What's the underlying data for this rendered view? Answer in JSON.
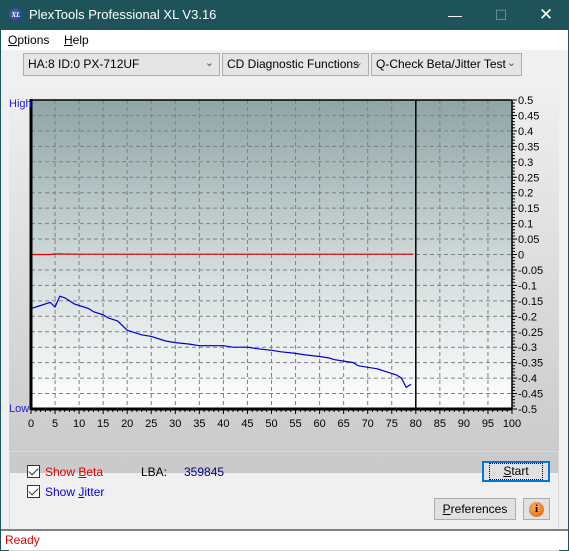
{
  "window": {
    "title": "PlexTools Professional XL V3.16",
    "icon_text": "XL",
    "controls": [
      "minimize",
      "maximize",
      "close"
    ]
  },
  "menu": {
    "items": [
      {
        "label": "Options",
        "mnemonic": "O",
        "rest": "ptions"
      },
      {
        "label": "Help",
        "mnemonic": "H",
        "rest": "elp"
      }
    ]
  },
  "toolbar": {
    "drive_select": "HA:8 ID:0  PX-712UF",
    "function_select": "CD Diagnostic Functions",
    "test_select": "Q-Check Beta/Jitter Test"
  },
  "chart_data": {
    "type": "line",
    "title": "",
    "left_axis_labels": {
      "high": "High",
      "low": "Low"
    },
    "xlabel": "",
    "ylabel": "",
    "xlim": [
      0,
      100
    ],
    "ylim": [
      -0.5,
      0.5
    ],
    "x_ticks": [
      0,
      5,
      10,
      15,
      20,
      25,
      30,
      35,
      40,
      45,
      50,
      55,
      60,
      65,
      70,
      75,
      80,
      85,
      90,
      95,
      100
    ],
    "y_ticks": [
      0.5,
      0.45,
      0.4,
      0.35,
      0.3,
      0.25,
      0.2,
      0.15,
      0.1,
      0.05,
      0,
      -0.05,
      -0.1,
      -0.15,
      -0.2,
      -0.25,
      -0.3,
      -0.35,
      -0.4,
      -0.45,
      -0.5
    ],
    "y_tick_labels": [
      "0.5",
      "0.45",
      "0.4",
      "0.35",
      "0.3",
      "0.25",
      "0.2",
      "0.15",
      "0.1",
      "0.05",
      "0",
      "-0.05",
      "-0.1",
      "-0.15",
      "-0.2",
      "-0.25",
      "-0.3",
      "-0.35",
      "-0.4",
      "-0.45",
      "-0.5"
    ],
    "grid": true,
    "end_marker_x": 80,
    "series": [
      {
        "name": "Beta",
        "color": "#e00000",
        "x": [
          0,
          4,
          5,
          10,
          15,
          20,
          30,
          40,
          50,
          60,
          70,
          79.5
        ],
        "y": [
          0,
          0,
          0.002,
          0.001,
          0.001,
          0.001,
          0.001,
          0.001,
          0.001,
          0.001,
          0.001,
          0.001
        ]
      },
      {
        "name": "Jitter",
        "color": "#0000cc",
        "x": [
          0,
          2,
          3,
          4,
          5,
          6,
          7,
          8,
          9,
          10,
          12,
          13,
          15,
          16,
          17,
          18,
          19,
          20,
          21,
          23,
          25,
          27,
          28,
          30,
          33,
          35,
          37,
          40,
          42,
          45,
          47,
          50,
          52,
          55,
          57,
          60,
          62,
          63,
          65,
          67,
          68,
          70,
          72,
          74,
          76,
          77,
          78,
          79
        ],
        "y": [
          -0.175,
          -0.165,
          -0.16,
          -0.155,
          -0.17,
          -0.135,
          -0.14,
          -0.15,
          -0.16,
          -0.165,
          -0.175,
          -0.185,
          -0.195,
          -0.205,
          -0.21,
          -0.215,
          -0.23,
          -0.245,
          -0.25,
          -0.26,
          -0.265,
          -0.275,
          -0.28,
          -0.285,
          -0.29,
          -0.295,
          -0.295,
          -0.295,
          -0.3,
          -0.3,
          -0.305,
          -0.31,
          -0.315,
          -0.32,
          -0.325,
          -0.33,
          -0.335,
          -0.34,
          -0.345,
          -0.35,
          -0.36,
          -0.365,
          -0.37,
          -0.38,
          -0.39,
          -0.4,
          -0.43,
          -0.42
        ]
      }
    ]
  },
  "controls": {
    "show_beta_label": "Show Beta",
    "show_beta_pre": "Show ",
    "show_beta_mn": "B",
    "show_beta_post": "eta",
    "show_beta_checked": true,
    "show_jitter_pre": "Show ",
    "show_jitter_mn": "J",
    "show_jitter_post": "itter",
    "show_jitter_checked": true,
    "lba_label": "LBA:",
    "lba_value": "359845",
    "start_pre": "S",
    "start_post": "tart",
    "preferences_pre": "P",
    "preferences_post": "references",
    "info_icon": "i"
  },
  "status": {
    "text": "Ready"
  }
}
